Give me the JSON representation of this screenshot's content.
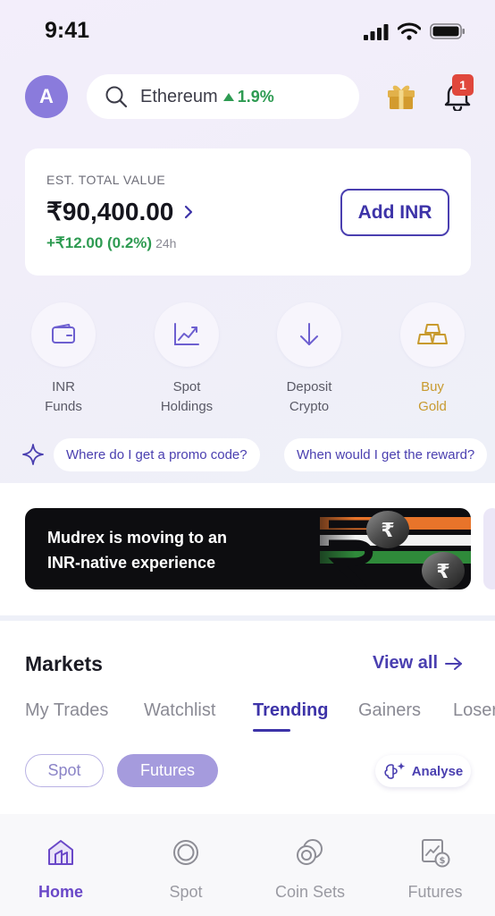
{
  "status_bar": {
    "time": "9:41"
  },
  "header": {
    "avatar_initial": "A",
    "search": {
      "coin": "Ethereum",
      "change": "1.9%"
    },
    "notifications_count": "1"
  },
  "portfolio": {
    "label": "EST. TOTAL VALUE",
    "amount": "₹90,400.00",
    "change": "+₹12.00 (0.2%)",
    "period": "24h",
    "add_button": "Add INR"
  },
  "quick_actions": [
    {
      "line1": "INR",
      "line2": "Funds",
      "icon": "wallet-icon"
    },
    {
      "line1": "Spot",
      "line2": "Holdings",
      "icon": "chart-icon"
    },
    {
      "line1": "Deposit",
      "line2": "Crypto",
      "icon": "arrow-down-icon"
    },
    {
      "line1": "Buy",
      "line2": "Gold",
      "icon": "gold-bars-icon"
    }
  ],
  "prompt_chips": [
    "Where do I get a promo code?",
    "When would I get the reward?"
  ],
  "banner": {
    "line1": "Mudrex is moving to an",
    "line2": "INR-native experience"
  },
  "markets": {
    "title": "Markets",
    "view_all": "View all",
    "tabs": [
      "My Trades",
      "Watchlist",
      "Trending",
      "Gainers",
      "Losers"
    ],
    "active_tab": "Trending",
    "filters": [
      "Spot",
      "Futures"
    ],
    "selected_filter": "Futures",
    "analyse": "Analyse"
  },
  "bottom_nav": [
    {
      "label": "Home",
      "icon": "home-icon"
    },
    {
      "label": "Spot",
      "icon": "spot-icon"
    },
    {
      "label": "Coin Sets",
      "icon": "coin-sets-icon"
    },
    {
      "label": "Futures",
      "icon": "futures-icon"
    }
  ],
  "colors": {
    "accent": "#4a3fb0",
    "positive": "#2e9b52",
    "gold": "#c89a2e",
    "badge": "#e0473c"
  }
}
